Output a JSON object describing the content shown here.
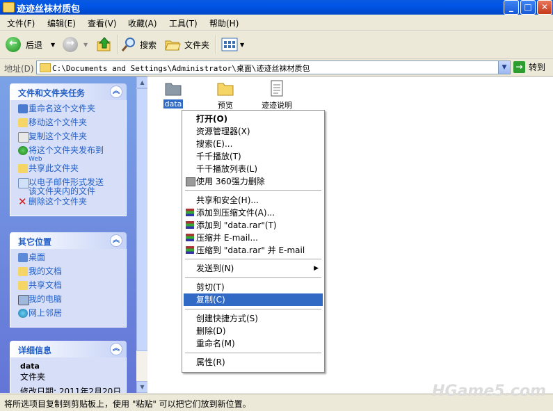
{
  "window": {
    "title": "迹迹丝袜材质包",
    "buttons": {
      "minimize": "_",
      "maximize": "□",
      "close": "✕"
    }
  },
  "menu": [
    "文件(F)",
    "编辑(E)",
    "查看(V)",
    "收藏(A)",
    "工具(T)",
    "帮助(H)"
  ],
  "toolbar": {
    "back": "后退",
    "forward": "",
    "search": "搜索",
    "folders": "文件夹"
  },
  "address": {
    "label": "地址(D)",
    "path": "C:\\Documents and Settings\\Administrator\\桌面\\迹迹丝袜材质包",
    "go": "转到"
  },
  "tasks": {
    "title": "文件和文件夹任务",
    "items": [
      "重命名这个文件夹",
      "移动这个文件夹",
      "复制这个文件夹",
      "将这个文件夹发布到",
      "Web",
      "共享此文件夹",
      "以电子邮件形式发送",
      "该文件夹内的文件",
      "删除这个文件夹"
    ]
  },
  "places": {
    "title": "其它位置",
    "items": [
      "桌面",
      "我的文档",
      "共享文档",
      "我的电脑",
      "网上邻居"
    ]
  },
  "details": {
    "title": "详细信息",
    "name": "data",
    "type": "文件夹",
    "modified": "修改日期: 2011年2月20日"
  },
  "files": [
    {
      "name": "data",
      "kind": "folder-grey"
    },
    {
      "name": "预览",
      "kind": "folder"
    },
    {
      "name": "迹迹说明",
      "kind": "notepad"
    }
  ],
  "context_menu": {
    "items": [
      {
        "label": "打开(O)",
        "bold": true
      },
      {
        "label": "资源管理器(X)"
      },
      {
        "label": "搜索(E)..."
      },
      {
        "label": "千千播放(T)"
      },
      {
        "label": "千千播放列表(L)"
      },
      {
        "label": "使用 360强力删除"
      },
      {
        "label": "共享和安全(H)..."
      },
      {
        "label": "添加到压缩文件(A)..."
      },
      {
        "label": "添加到 \"data.rar\"(T)"
      },
      {
        "label": "压缩并 E-mail..."
      },
      {
        "label": "压缩到 \"data.rar\" 并 E-mail"
      },
      {
        "label": "发送到(N)"
      },
      {
        "label": "剪切(T)"
      },
      {
        "label": "复制(C)",
        "highlight": true
      },
      {
        "label": "创建快捷方式(S)"
      },
      {
        "label": "删除(D)"
      },
      {
        "label": "重命名(M)"
      },
      {
        "label": "属性(R)"
      }
    ]
  },
  "status_text": "将所选项目复制到剪贴板上，使用 \"粘贴\" 可以把它们放到新位置。",
  "watermark": "HGame5.com",
  "colors": {
    "title_blue": "#0055e6",
    "highlight": "#316ac5",
    "panel_link": "#215dc6"
  }
}
